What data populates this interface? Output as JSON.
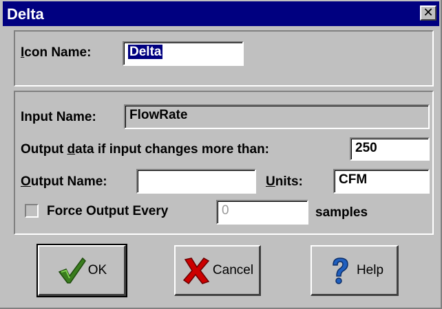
{
  "window": {
    "title": "Delta",
    "close_symbol": "✕"
  },
  "icon_name": {
    "label_accel": "I",
    "label_rest": "con Name:",
    "value": "Delta"
  },
  "input_name": {
    "label": "Input Name:",
    "value": "FlowRate"
  },
  "output_threshold": {
    "label_pre": "Output ",
    "label_accel": "d",
    "label_post": "ata if input changes more than:",
    "value": "250"
  },
  "output_name": {
    "label_accel": "O",
    "label_rest": "utput Name:",
    "value": ""
  },
  "units": {
    "label_accel": "U",
    "label_rest": "nits:",
    "value": "CFM"
  },
  "force_output": {
    "label": "Force Output Every",
    "value": "0",
    "suffix": "samples",
    "checked": false
  },
  "buttons": {
    "ok": {
      "label": "OK",
      "icon": "checkmark-icon"
    },
    "cancel": {
      "label": "Cancel",
      "icon": "red-x-icon"
    },
    "help": {
      "label": "Help",
      "icon": "question-mark-icon"
    }
  },
  "colors": {
    "titlebar": "#000080",
    "face": "#c0c0c0",
    "selection": "#000080",
    "ok_icon": "#3a7d1e",
    "cancel_icon": "#cc0000",
    "help_icon": "#1f5fbf"
  }
}
